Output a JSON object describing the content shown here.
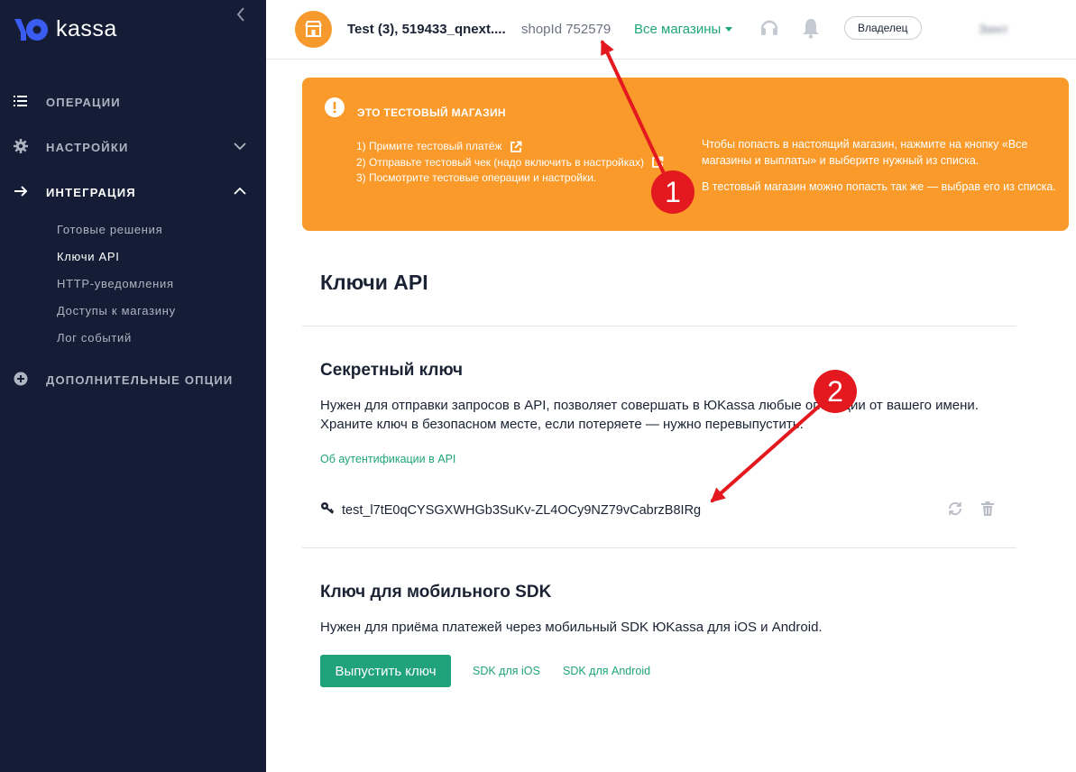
{
  "brand": {
    "logo_text": "kassa",
    "accent": "#1ea57a",
    "sidebar_bg": "#141d35",
    "banner_bg": "#f99a2a",
    "annotation_color": "#e3191f"
  },
  "sidebar": {
    "collapse_icon": "chevron-left-icon",
    "items": [
      {
        "label": "Операции",
        "icon": "list-icon"
      },
      {
        "label": "Настройки",
        "icon": "gear-icon"
      },
      {
        "label": "Интеграция",
        "icon": "arrow-right-icon"
      },
      {
        "label": "Дополнительные опции",
        "icon": "plus-circle-icon"
      }
    ],
    "integration_sub": [
      "Готовые решения",
      "Ключи API",
      "HTTP-уведомления",
      "Доступы к магазину",
      "Лог событий"
    ],
    "active_sub": "Ключи API"
  },
  "header": {
    "shop_name": "Test (3), 519433_qnext....",
    "shop_id": "shopId 752579",
    "all_shops": "Все магазины",
    "role": "Владелец",
    "user_name": "Зинт"
  },
  "banner": {
    "title": "ЭТО ТЕСТОВЫЙ МАГАЗИН",
    "steps": [
      "1) Примите тестовый платёж",
      "2) Отправьте тестовый чек (надо включить в настройках)",
      "3) Посмотрите тестовые операции и настройки."
    ],
    "right_p1": "Чтобы попасть в настоящий магазин, нажмите на кнопку «Все магазины и выплаты» и выберите нужный из списка.",
    "right_p2": "В тестовый магазин можно попасть так же — выбрав его из списка."
  },
  "main": {
    "page_title": "Ключи API",
    "secret": {
      "title": "Секретный ключ",
      "desc_line1": "Нужен для отправки запросов в API, позволяет совершать в ЮKassa любые операции от вашего имени.",
      "desc_line2": "Храните ключ в безопасном месте, если потеряете — нужно перевыпустить.",
      "auth_link": "Об аутентификации в API",
      "key": "test_l7tE0qCYSGXWHGb3SuKv-ZL4OCy9NZ79vCabrzB8IRg"
    },
    "sdk": {
      "title": "Ключ для мобильного SDK",
      "desc": "Нужен для приёма платежей через мобильный SDK ЮKassa для iOS и Android.",
      "issue_button": "Выпустить ключ",
      "ios_link": "SDK для iOS",
      "android_link": "SDK для Android"
    }
  },
  "annotations": {
    "badge1": "1",
    "badge2": "2"
  }
}
